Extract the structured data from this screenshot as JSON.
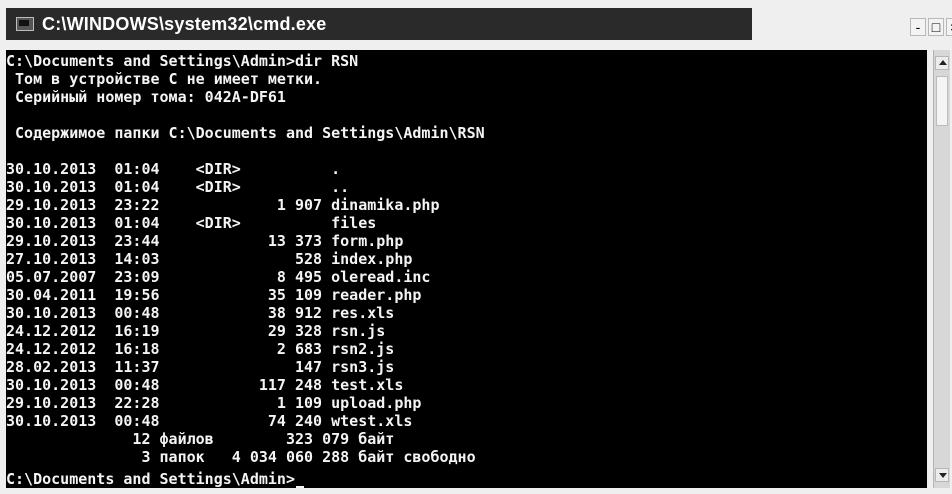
{
  "window": {
    "title": "C:\\WINDOWS\\system32\\cmd.exe",
    "controls": {
      "minimize": "-",
      "maximize": "□",
      "close": "×"
    }
  },
  "console": {
    "lines": [
      "C:\\Documents and Settings\\Admin>dir RSN",
      " Том в устройстве C не имеет метки.",
      " Серийный номер тома: 042A-DF61",
      "",
      " Содержимое папки C:\\Documents and Settings\\Admin\\RSN",
      "",
      "30.10.2013  01:04    <DIR>          .",
      "30.10.2013  01:04    <DIR>          ..",
      "29.10.2013  23:22             1 907 dinamika.php",
      "30.10.2013  01:04    <DIR>          files",
      "29.10.2013  23:44            13 373 form.php",
      "27.10.2013  14:03               528 index.php",
      "05.07.2007  23:09             8 495 oleread.inc",
      "30.04.2011  19:56            35 109 reader.php",
      "30.10.2013  00:48            38 912 res.xls",
      "24.12.2012  16:19            29 328 rsn.js",
      "24.12.2012  16:18             2 683 rsn2.js",
      "28.02.2013  11:37               147 rsn3.js",
      "30.10.2013  00:48           117 248 test.xls",
      "29.10.2013  22:28             1 109 upload.php",
      "30.10.2013  00:48            74 240 wtest.xls",
      "              12 файлов        323 079 байт",
      "               3 папок   4 034 060 288 байт свободно",
      "",
      "C:\\Documents and Settings\\Admin>"
    ]
  },
  "icons": {
    "window_icon": "cmd-icon",
    "scroll_up": "arrow-up-icon",
    "scroll_down": "arrow-down-icon"
  }
}
